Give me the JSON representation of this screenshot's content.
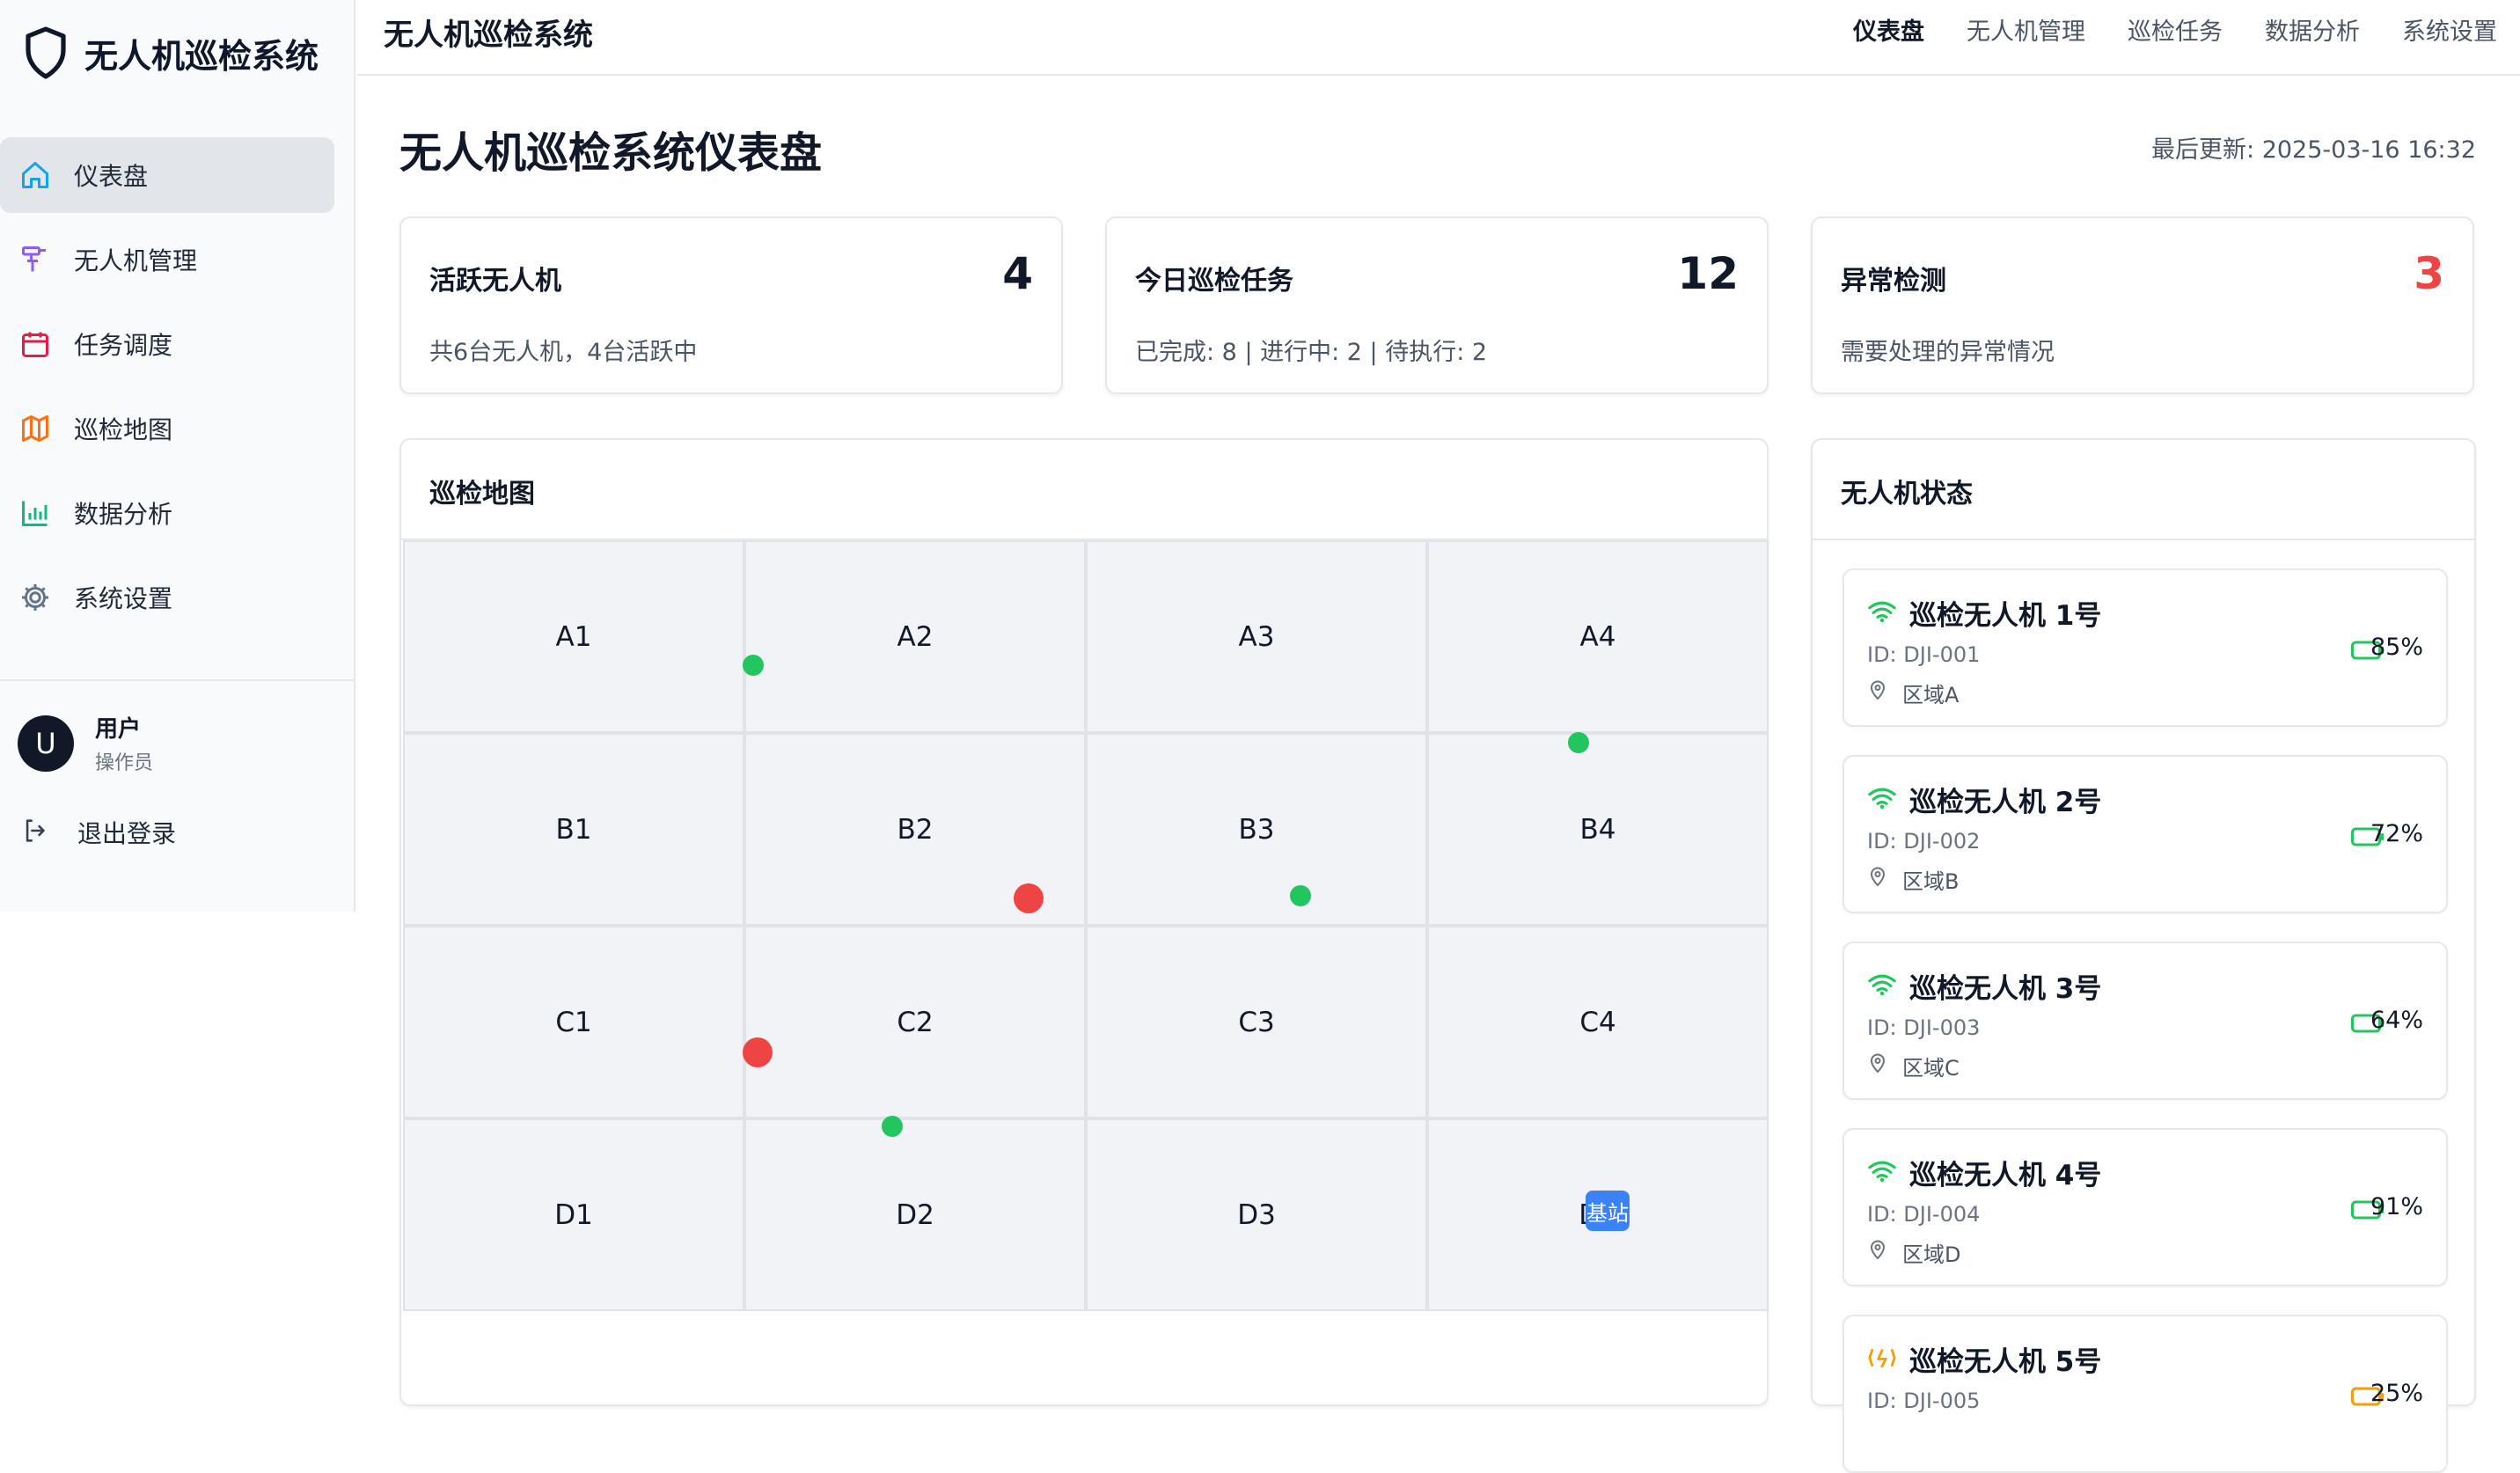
{
  "app": {
    "brand": "无人机巡检系统",
    "top_title": "无人机巡检系统"
  },
  "topnav": [
    {
      "label": "仪表盘",
      "active": true
    },
    {
      "label": "无人机管理"
    },
    {
      "label": "巡检任务"
    },
    {
      "label": "数据分析"
    },
    {
      "label": "系统设置"
    }
  ],
  "sidebar": {
    "items": [
      {
        "label": "仪表盘",
        "icon": "home-icon",
        "active": true
      },
      {
        "label": "无人机管理",
        "icon": "drone-icon"
      },
      {
        "label": "任务调度",
        "icon": "calendar-icon"
      },
      {
        "label": "巡检地图",
        "icon": "map-icon"
      },
      {
        "label": "数据分析",
        "icon": "bar-chart-icon"
      },
      {
        "label": "系统设置",
        "icon": "gear-icon"
      }
    ],
    "user": {
      "avatar": "U",
      "name": "用户",
      "role": "操作员"
    },
    "logout": "退出登录"
  },
  "page": {
    "title": "无人机巡检系统仪表盘",
    "updated": "最后更新: 2025-03-16 16:32"
  },
  "stats": [
    {
      "label": "活跃无人机",
      "value": "4",
      "desc": "共6台无人机，4台活跃中",
      "color": "#111827"
    },
    {
      "label": "今日巡检任务",
      "value": "12",
      "desc": "已完成: 8 | 进行中: 2 | 待执行: 2",
      "color": "#111827"
    },
    {
      "label": "异常检测",
      "value": "3",
      "desc": "需要处理的异常情况",
      "color": "#ef4444"
    }
  ],
  "map": {
    "title": "巡检地图",
    "cells": [
      "A1",
      "A2",
      "A3",
      "A4",
      "B1",
      "B2",
      "B3",
      "B4",
      "C1",
      "C2",
      "C3",
      "C4",
      "D1",
      "D2",
      "D3",
      "D4"
    ],
    "base_label": "基站"
  },
  "status": {
    "title": "无人机状态",
    "drones": [
      {
        "name": "巡检无人机 1号",
        "id": "ID: DJI-001",
        "area": "区域A",
        "battery": "85%",
        "signal_color": "#22c55e",
        "battery_color": "#22c55e"
      },
      {
        "name": "巡检无人机 2号",
        "id": "ID: DJI-002",
        "area": "区域B",
        "battery": "72%",
        "signal_color": "#22c55e",
        "battery_color": "#22c55e"
      },
      {
        "name": "巡检无人机 3号",
        "id": "ID: DJI-003",
        "area": "区域C",
        "battery": "64%",
        "signal_color": "#22c55e",
        "battery_color": "#22c55e"
      },
      {
        "name": "巡检无人机 4号",
        "id": "ID: DJI-004",
        "area": "区域D",
        "battery": "91%",
        "signal_color": "#22c55e",
        "battery_color": "#22c55e"
      },
      {
        "name": "巡检无人机 5号",
        "id": "ID: DJI-005",
        "area": "",
        "battery": "25%",
        "signal_color": "#f59e0b",
        "battery_color": "#f59e0b"
      }
    ]
  }
}
